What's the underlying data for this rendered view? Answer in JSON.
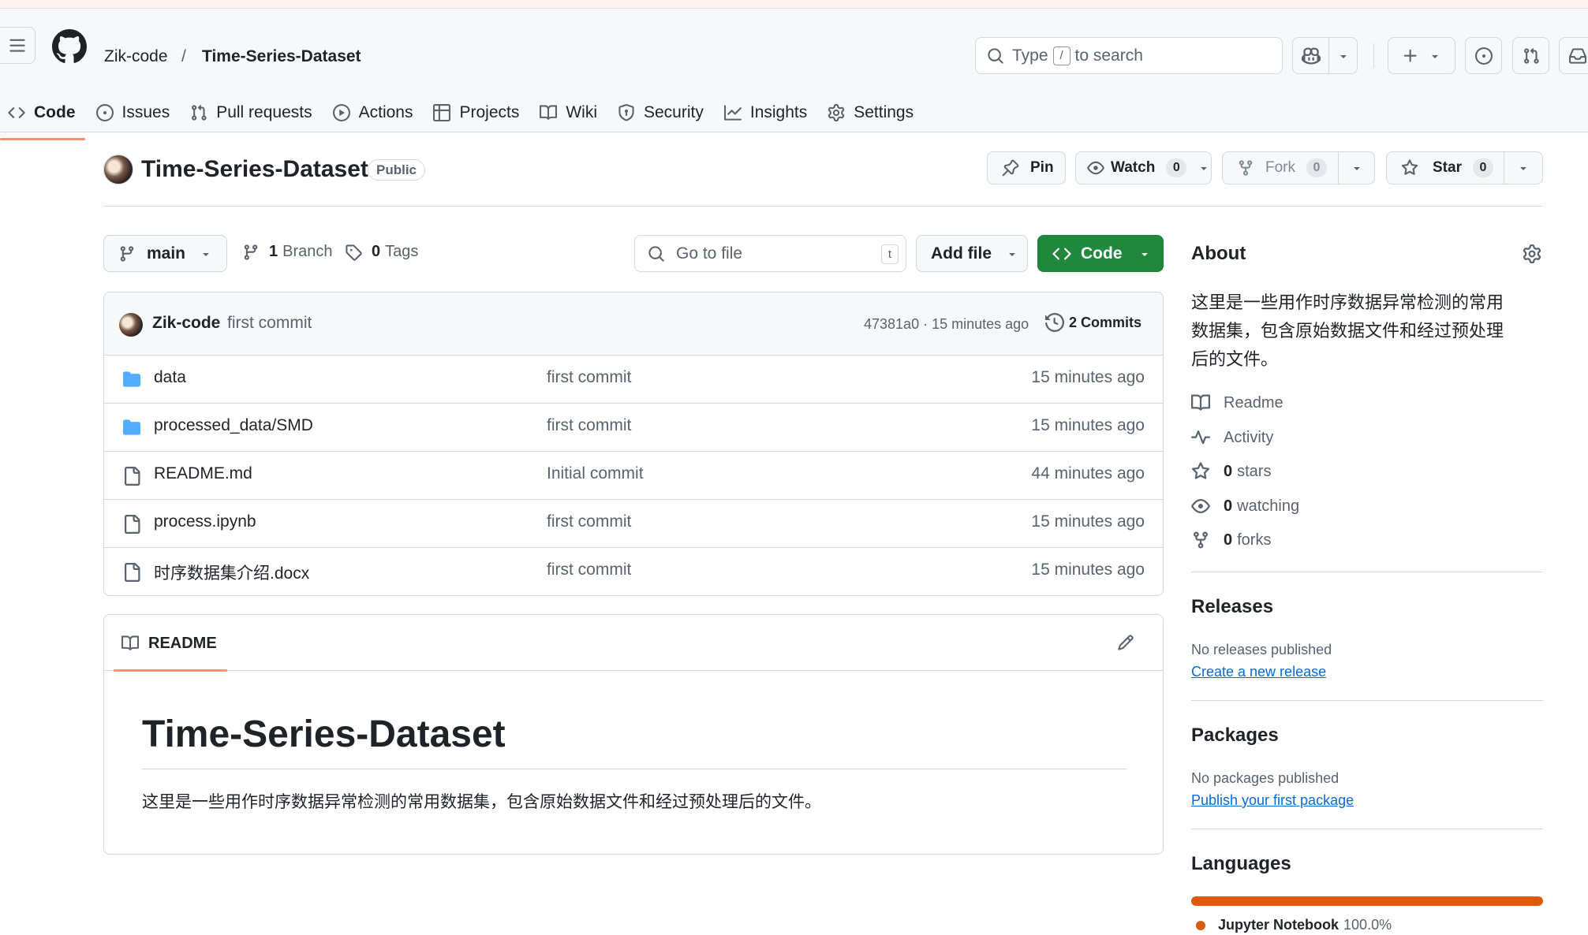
{
  "header": {
    "owner": "Zik-code",
    "separator": "/",
    "repo": "Time-Series-Dataset",
    "search": {
      "pre": "Type",
      "key": "/",
      "post": "to search"
    }
  },
  "nav": {
    "tabs": [
      {
        "label": "Code",
        "icon": "code-icon",
        "active": true
      },
      {
        "label": "Issues",
        "icon": "issue-opened-icon"
      },
      {
        "label": "Pull requests",
        "icon": "git-pull-request-icon"
      },
      {
        "label": "Actions",
        "icon": "play-icon"
      },
      {
        "label": "Projects",
        "icon": "table-icon"
      },
      {
        "label": "Wiki",
        "icon": "book-icon"
      },
      {
        "label": "Security",
        "icon": "shield-icon"
      },
      {
        "label": "Insights",
        "icon": "graph-icon"
      },
      {
        "label": "Settings",
        "icon": "gear-icon"
      }
    ]
  },
  "repo": {
    "title": "Time-Series-Dataset",
    "visibility": "Public",
    "pin": "Pin",
    "watch": "Watch",
    "watch_count": "0",
    "fork": "Fork",
    "fork_count": "0",
    "star": "Star",
    "star_count": "0"
  },
  "toolbar": {
    "branch": "main",
    "branches_count": "1",
    "branches_label": "Branch",
    "tags_count": "0",
    "tags_label": "Tags",
    "goto_placeholder": "Go to file",
    "goto_key": "t",
    "add_file": "Add file",
    "code": "Code"
  },
  "commit": {
    "author": "Zik-code",
    "message": "first commit",
    "meta": "47381a0 · 15 minutes ago",
    "commits": "2 Commits"
  },
  "files": [
    {
      "name": "data",
      "type": "dir",
      "message": "first commit",
      "date": "15 minutes ago"
    },
    {
      "name": "processed_data/SMD",
      "type": "dir",
      "message": "first commit",
      "date": "15 minutes ago"
    },
    {
      "name": "README.md",
      "type": "file",
      "message": "Initial commit",
      "date": "44 minutes ago"
    },
    {
      "name": "process.ipynb",
      "type": "file",
      "message": "first commit",
      "date": "15 minutes ago"
    },
    {
      "name": "时序数据集介绍.docx",
      "type": "file",
      "message": "first commit",
      "date": "15 minutes ago"
    }
  ],
  "readme": {
    "tab": "README",
    "heading": "Time-Series-Dataset",
    "body": "这里是一些用作时序数据异常检测的常用数据集，包含原始数据文件和经过预处理后的文件。"
  },
  "about": {
    "title": "About",
    "description_lines": [
      "这里是一些用作时序数据异常检测的常用",
      "数据集，包含原始数据文件和经过预处理",
      "后的文件。"
    ],
    "readme": "Readme",
    "activity": "Activity",
    "stars_count": "0",
    "stars_label": "stars",
    "watching_count": "0",
    "watching_label": "watching",
    "forks_count": "0",
    "forks_label": "forks"
  },
  "releases": {
    "title": "Releases",
    "empty": "No releases published",
    "link": "Create a new release"
  },
  "packages": {
    "title": "Packages",
    "empty": "No packages published",
    "link": "Publish your first package"
  },
  "languages": {
    "title": "Languages",
    "items": [
      {
        "name": "Jupyter Notebook",
        "percent": "100.0%",
        "fraction": 1.0,
        "color": "#da5b0b"
      }
    ]
  },
  "colors": {
    "primary": "#1f883d",
    "accent_tab": "#fd8c73",
    "folder": "#54aeff",
    "link": "#0969da"
  }
}
